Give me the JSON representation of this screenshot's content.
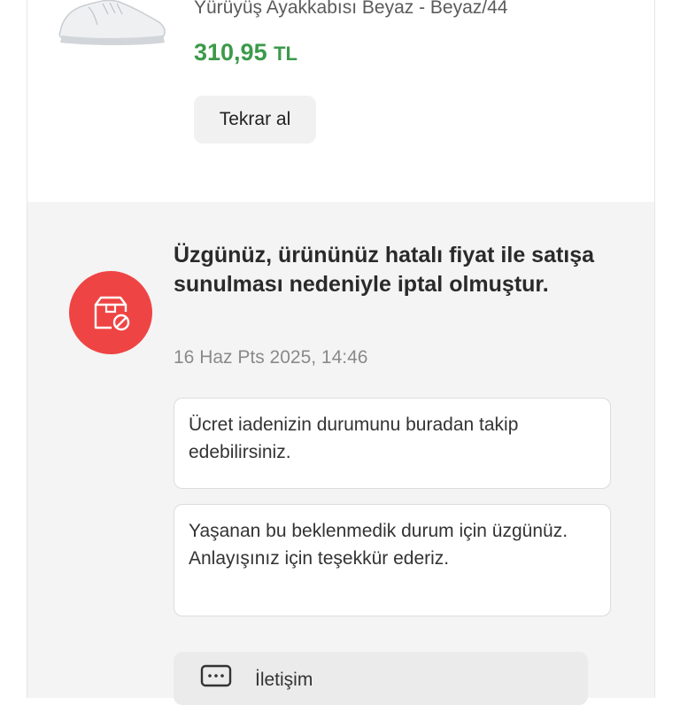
{
  "product": {
    "name": "Yürüyüş Ayakkabısı Beyaz - Beyaz/44",
    "price_amount": "310,95",
    "price_currency": "TL",
    "rebuy_label": "Tekrar al"
  },
  "cancellation": {
    "title": "Üzgünüz, ürününüz hatalı fiyat ile satışa sunulması nedeniyle iptal olmuştur.",
    "date": "16 Haz Pts 2025, 14:46",
    "icon": "cancelled-box-icon",
    "accent_color": "#ef4444",
    "messages": [
      "Ücret iadenizin durumunu buradan takip edebilirsiniz.",
      "Yaşanan bu beklenmedik durum için üzgünüz. Anlayışınız için teşekkür ederiz."
    ]
  },
  "contact": {
    "label": "İletişim",
    "icon": "message-icon"
  }
}
